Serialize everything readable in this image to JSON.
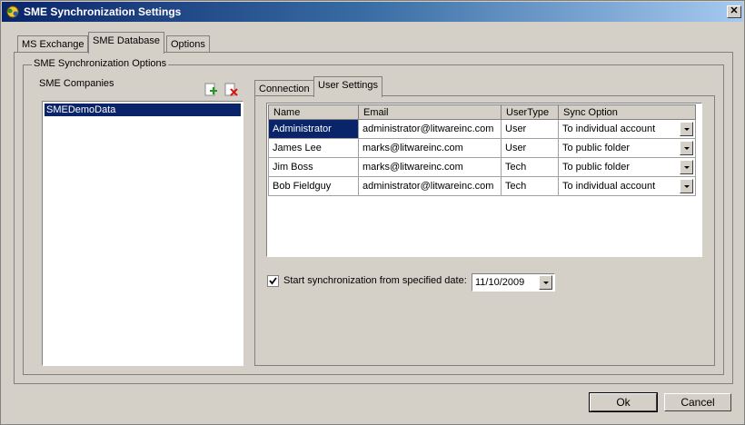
{
  "window": {
    "title": "SME Synchronization Settings"
  },
  "main_tabs": [
    "MS Exchange",
    "SME Database",
    "Options"
  ],
  "group": {
    "label": "SME Synchronization Options",
    "companies_label": "SME Companies",
    "companies": [
      "SMEDemoData"
    ]
  },
  "inner_tabs": [
    "Connection",
    "User Settings"
  ],
  "grid": {
    "columns": [
      "Name",
      "Email",
      "UserType",
      "Sync Option"
    ],
    "rows": [
      [
        "Administrator",
        "administrator@litwareinc.com",
        "User",
        "To individual account"
      ],
      [
        "James Lee",
        "marks@litwareinc.com",
        "User",
        "To public folder"
      ],
      [
        "Jim Boss",
        "marks@litwareinc.com",
        "Tech",
        "To public folder"
      ],
      [
        "Bob Fieldguy",
        "administrator@litwareinc.com",
        "Tech",
        "To individual account"
      ]
    ]
  },
  "sync_date": {
    "checked": true,
    "label": "Start synchronization from specified date:",
    "value": "11/10/2009"
  },
  "buttons": {
    "ok": "Ok",
    "cancel": "Cancel"
  },
  "icons": {
    "app": "sync-app-icon",
    "add": "add-company-icon",
    "delete": "delete-company-icon",
    "close": "close-icon"
  }
}
